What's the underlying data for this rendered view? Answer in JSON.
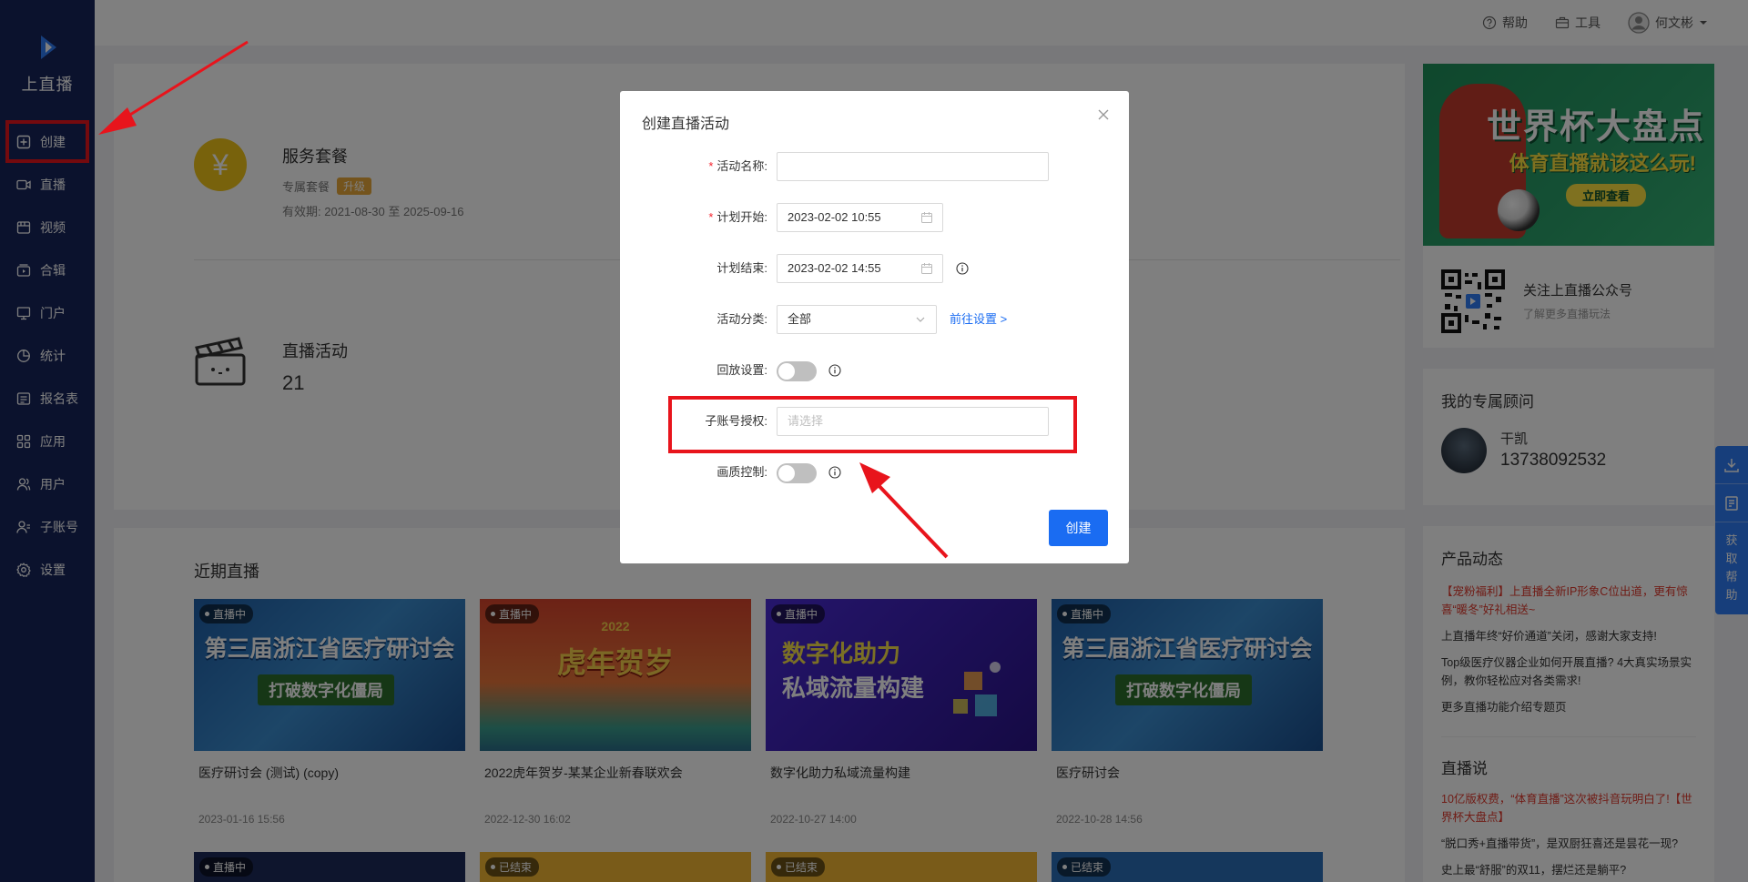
{
  "sidebar": {
    "logo_text": "上直播",
    "items": [
      {
        "label": "创建",
        "icon": "plus-square-icon"
      },
      {
        "label": "直播",
        "icon": "video-camera-icon"
      },
      {
        "label": "视频",
        "icon": "film-icon"
      },
      {
        "label": "合辑",
        "icon": "collection-icon"
      },
      {
        "label": "门户",
        "icon": "monitor-icon"
      },
      {
        "label": "统计",
        "icon": "pie-chart-icon"
      },
      {
        "label": "报名表",
        "icon": "form-icon"
      },
      {
        "label": "应用",
        "icon": "apps-icon"
      },
      {
        "label": "用户",
        "icon": "users-icon"
      },
      {
        "label": "子账号",
        "icon": "sub-account-icon"
      },
      {
        "label": "设置",
        "icon": "gear-icon"
      }
    ]
  },
  "topbar": {
    "help": "帮助",
    "tools": "工具",
    "user": "何文彬"
  },
  "service": {
    "title": "服务套餐",
    "plan": "专属套餐",
    "upgrade": "升级",
    "validity_label": "有效期:",
    "validity": "2021-08-30 至 2025-09-16",
    "activities_title": "直播活动",
    "activities_count": "21"
  },
  "recent": {
    "title": "近期直播",
    "videos": [
      {
        "status": "直播中",
        "title": "医疗研讨会 (测试) (copy)",
        "date": "2023-01-16 15:56",
        "poster_title": "第三届浙江省医疗研讨会",
        "poster_sub": "打破数字化僵局"
      },
      {
        "status": "直播中",
        "title": "2022虎年贺岁-某某企业新春联欢会",
        "date": "2022-12-30 16:02",
        "poster_title": "虎年贺岁",
        "poster_sub": "2022"
      },
      {
        "status": "直播中",
        "title": "数字化助力私域流量构建",
        "date": "2022-10-27 14:00",
        "poster_title": "数字化助力",
        "poster_sub": "私域流量构建"
      },
      {
        "status": "直播中",
        "title": "医疗研讨会",
        "date": "2022-10-28 14:56",
        "poster_title": "第三届浙江省医疗研讨会",
        "poster_sub": "打破数字化僵局"
      }
    ],
    "row2_status": [
      "直播中",
      "已结束",
      "已结束",
      "已结束"
    ]
  },
  "promo": {
    "title": "世界杯大盘点",
    "subtitle": "体育直播就该这么玩!",
    "button": "立即查看"
  },
  "wechat": {
    "title": "关注上直播公众号",
    "subtitle": "了解更多直播玩法"
  },
  "advisor": {
    "title": "我的专属顾问",
    "name": "干凯",
    "phone": "13738092532"
  },
  "product_news": {
    "title": "产品动态",
    "items": [
      {
        "text": "【宠粉福利】上直播全新IP形象C位出道，更有惊喜“暖冬”好礼相送~",
        "highlight": true
      },
      {
        "text": "上直播年终“好价通道”关闭，感谢大家支持!",
        "highlight": false
      },
      {
        "text": "Top级医疗仪器企业如何开展直播? 4大真实场景实例，教你轻松应对各类需求!",
        "highlight": false
      },
      {
        "text": "更多直播功能介绍专题页",
        "highlight": false
      }
    ]
  },
  "live_talk": {
    "title": "直播说",
    "items": [
      {
        "text": "10亿版权费，“体育直播”这次被抖音玩明白了!【世界杯大盘点】",
        "highlight": true
      },
      {
        "text": "“脱口秀+直播带货”，是双厨狂喜还是昙花一现?",
        "highlight": false
      },
      {
        "text": "史上最“舒服”的双11，摆烂还是躺平?",
        "highlight": false
      }
    ]
  },
  "float_tab": {
    "text": [
      "获",
      "取",
      "帮",
      "助"
    ]
  },
  "modal": {
    "title": "创建直播活动",
    "fields": {
      "name_label": "活动名称:",
      "name_value": "",
      "start_label": "计划开始:",
      "start_value": "2023-02-02 10:55",
      "end_label": "计划结束:",
      "end_value": "2023-02-02 14:55",
      "category_label": "活动分类:",
      "category_value": "全部",
      "category_link": "前往设置 >",
      "replay_label": "回放设置:",
      "replay_on": false,
      "subaccount_label": "子账号授权:",
      "subaccount_placeholder": "请选择",
      "quality_label": "画质控制:",
      "quality_on": false
    },
    "submit": "创建"
  },
  "colors": {
    "sidebar_bg": "#17245a",
    "primary": "#1a6cf2",
    "annotation_red": "#e8141c",
    "required": "#f5222d"
  }
}
